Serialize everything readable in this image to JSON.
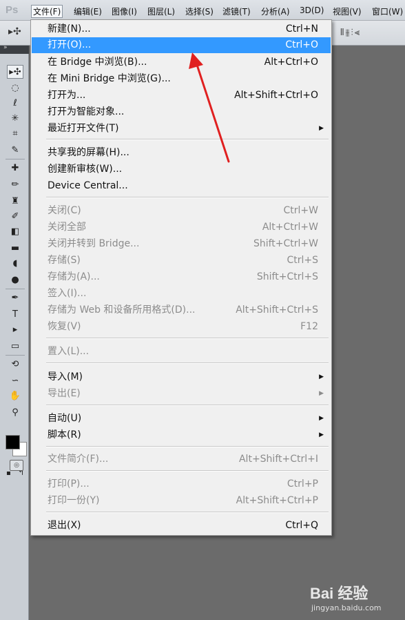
{
  "app": {
    "logo": "Ps"
  },
  "menubar": {
    "items": [
      {
        "label": "文件(F)",
        "active": true
      },
      {
        "label": "编辑(E)"
      },
      {
        "label": "图像(I)"
      },
      {
        "label": "图层(L)"
      },
      {
        "label": "选择(S)"
      },
      {
        "label": "滤镜(T)"
      },
      {
        "label": "分析(A)"
      },
      {
        "label": "3D(D)"
      },
      {
        "label": "视图(V)"
      },
      {
        "label": "窗口(W)"
      }
    ]
  },
  "file_menu": {
    "items": [
      {
        "label": "新建(N)...",
        "shortcut": "Ctrl+N"
      },
      {
        "label": "打开(O)...",
        "shortcut": "Ctrl+O",
        "highlighted": true
      },
      {
        "label": "在 Bridge 中浏览(B)...",
        "shortcut": "Alt+Ctrl+O"
      },
      {
        "label": "在 Mini Bridge 中浏览(G)...",
        "shortcut": ""
      },
      {
        "label": "打开为...",
        "shortcut": "Alt+Shift+Ctrl+O"
      },
      {
        "label": "打开为智能对象...",
        "shortcut": ""
      },
      {
        "label": "最近打开文件(T)",
        "shortcut": "",
        "submenu": true
      },
      {
        "label": "共享我的屏幕(H)...",
        "shortcut": ""
      },
      {
        "label": "创建新审核(W)...",
        "shortcut": ""
      },
      {
        "label": "Device Central...",
        "shortcut": ""
      },
      {
        "label": "关闭(C)",
        "shortcut": "Ctrl+W",
        "disabled": true
      },
      {
        "label": "关闭全部",
        "shortcut": "Alt+Ctrl+W",
        "disabled": true
      },
      {
        "label": "关闭并转到 Bridge...",
        "shortcut": "Shift+Ctrl+W",
        "disabled": true
      },
      {
        "label": "存储(S)",
        "shortcut": "Ctrl+S",
        "disabled": true
      },
      {
        "label": "存储为(A)...",
        "shortcut": "Shift+Ctrl+S",
        "disabled": true
      },
      {
        "label": "签入(I)...",
        "shortcut": "",
        "disabled": true
      },
      {
        "label": "存储为 Web 和设备所用格式(D)...",
        "shortcut": "Alt+Shift+Ctrl+S",
        "disabled": true
      },
      {
        "label": "恢复(V)",
        "shortcut": "F12",
        "disabled": true
      },
      {
        "label": "置入(L)...",
        "shortcut": "",
        "disabled": true
      },
      {
        "label": "导入(M)",
        "shortcut": "",
        "submenu": true
      },
      {
        "label": "导出(E)",
        "shortcut": "",
        "submenu": true,
        "disabled": true
      },
      {
        "label": "自动(U)",
        "shortcut": "",
        "submenu": true
      },
      {
        "label": "脚本(R)",
        "shortcut": "",
        "submenu": true
      },
      {
        "label": "文件简介(F)...",
        "shortcut": "Alt+Shift+Ctrl+I",
        "disabled": true
      },
      {
        "label": "打印(P)...",
        "shortcut": "Ctrl+P",
        "disabled": true
      },
      {
        "label": "打印一份(Y)",
        "shortcut": "Alt+Shift+Ctrl+P",
        "disabled": true
      },
      {
        "label": "退出(X)",
        "shortcut": "Ctrl+Q"
      }
    ]
  },
  "watermark": {
    "brand": "Bai 经验",
    "url": "jingyan.baidu.com"
  },
  "colors": {
    "highlight": "#3399ff",
    "annotation_arrow": "#e02020",
    "workspace": "#6b6b6b"
  }
}
